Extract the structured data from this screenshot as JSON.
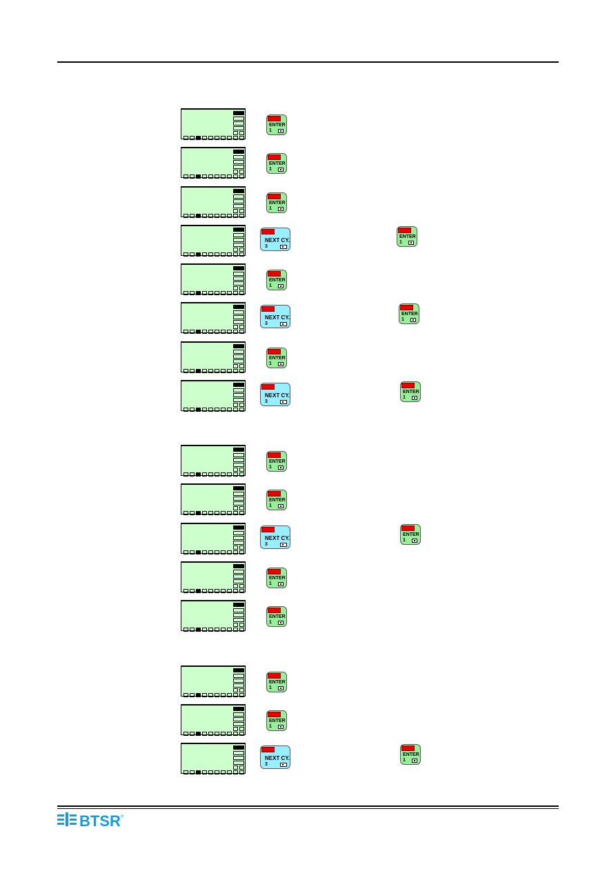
{
  "keys": {
    "enter": {
      "label": "ENTER",
      "number": "1"
    },
    "next": {
      "label": "NEXT CY.",
      "number": "3"
    }
  },
  "colors": {
    "lcd": "#ccffcc",
    "enter_key": "#99ee99",
    "next_key": "#99eeff",
    "led": "#ee0000",
    "logo": "#1a9ad6"
  },
  "logo": {
    "text": "BTSR",
    "mark": "®"
  },
  "rows": [
    {
      "keys": [
        "enter"
      ]
    },
    {
      "keys": [
        "enter"
      ]
    },
    {
      "keys": [
        "enter"
      ]
    },
    {
      "keys": [
        "next",
        "enter"
      ]
    },
    {
      "keys": [
        "enter"
      ]
    },
    {
      "keys": [
        "next",
        "enter"
      ]
    },
    {
      "keys": [
        "enter"
      ]
    },
    {
      "keys": [
        "next",
        "enter"
      ]
    },
    {
      "keys": [
        "enter"
      ]
    },
    {
      "keys": [
        "enter"
      ]
    },
    {
      "keys": [
        "next",
        "enter"
      ]
    },
    {
      "keys": [
        "enter"
      ]
    },
    {
      "keys": [
        "enter"
      ]
    },
    {
      "keys": [
        "enter"
      ]
    },
    {
      "keys": [
        "enter"
      ]
    },
    {
      "keys": [
        "next",
        "enter"
      ]
    }
  ]
}
